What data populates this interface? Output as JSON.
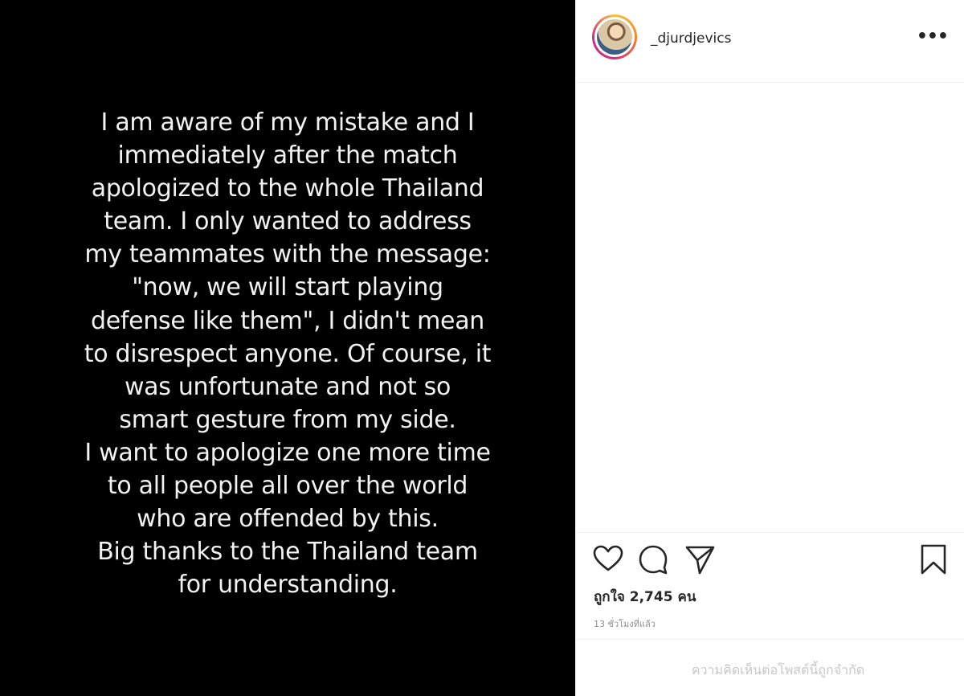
{
  "post": {
    "caption_lines": [
      "I am aware of my mistake and I",
      "immediately after the match",
      "apologized to the whole Thailand",
      "team. I only wanted to address",
      "my teammates with the message:",
      "\"now, we will start playing",
      "defense like them\", I didn't mean",
      "to disrespect anyone. Of course, it",
      "was unfortunate and not so",
      "smart gesture from my side.",
      "I want to apologize one more time",
      "to all people all over the world",
      "who are offended by this.",
      "Big thanks to the Thailand team",
      "for understanding."
    ]
  },
  "header": {
    "username": "_djurdjevics",
    "more_glyph": "•••"
  },
  "actions": {
    "icons": [
      "heart-icon",
      "comment-icon",
      "share-icon",
      "bookmark-icon"
    ]
  },
  "likes_text": "ถูกใจ 2,745 คน",
  "time_text": "13 ชั่วโมงที่แล้ว",
  "comments_limited_text": "ความคิดเห็นต่อโพสต์นี้ถูกจำกัด",
  "colors": {
    "media_bg": "#000000",
    "text_light": "#f2f2f2",
    "muted": "#8e8e8e",
    "border": "#efefef"
  }
}
